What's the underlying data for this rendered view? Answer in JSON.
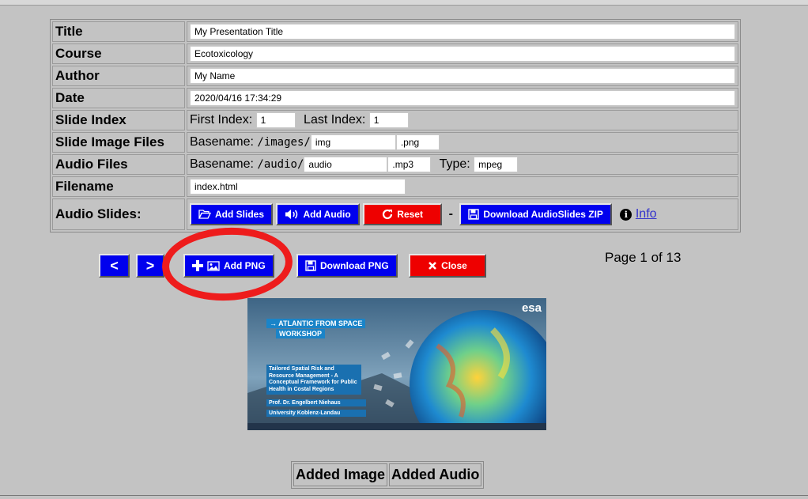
{
  "form": {
    "title_label": "Title",
    "title_value": "My Presentation Title",
    "course_label": "Course",
    "course_value": "Ecotoxicology",
    "author_label": "Author",
    "author_value": "My Name",
    "date_label": "Date",
    "date_value": "2020/04/16 17:34:29",
    "slide_index_label": "Slide Index",
    "first_index_label": "First Index:",
    "first_index_value": "1",
    "last_index_label": "Last Index:",
    "last_index_value": "1",
    "slide_image_files_label": "Slide Image Files",
    "image_basename_label": "Basename:",
    "image_path": "/images/",
    "image_basename_value": "img",
    "image_ext_value": ".png",
    "audio_files_label": "Audio Files",
    "audio_basename_label": "Basename:",
    "audio_path": "/audio/",
    "audio_basename_value": "audio",
    "audio_ext_value": ".mp3",
    "audio_type_label": "Type:",
    "audio_type_value": "mpeg",
    "filename_label": "Filename",
    "filename_value": "index.html",
    "audio_slides_label": "Audio Slides:"
  },
  "actions": {
    "add_slides": "Add Slides",
    "add_audio": "Add Audio",
    "reset": "Reset",
    "dash": "-",
    "download_zip": "Download AudioSlides ZIP",
    "info": "Info"
  },
  "navigation": {
    "prev": "<",
    "next": ">",
    "add_png": "Add PNG",
    "download_png": "Download PNG",
    "close": "Close",
    "page_info": "Page 1 of 13"
  },
  "slide": {
    "brand": "esa",
    "workshop_line1": "→ ATLANTIC FROM SPACE",
    "workshop_line2": "WORKSHOP",
    "talk_title": "Tailored Spatial Risk and Resource Management - A Conceptual Framework for Public Health in Costal Regions",
    "speaker": "Prof. Dr. Engelbert Niehaus",
    "university": "University Koblenz-Landau"
  },
  "bottom": {
    "col1": "Added Image",
    "col2": "Added Audio"
  },
  "colors": {
    "background": "#c3c3c3",
    "button_blue": "#0000ee",
    "button_red": "#ee0000",
    "highlight_circle": "#ee1c1c"
  }
}
